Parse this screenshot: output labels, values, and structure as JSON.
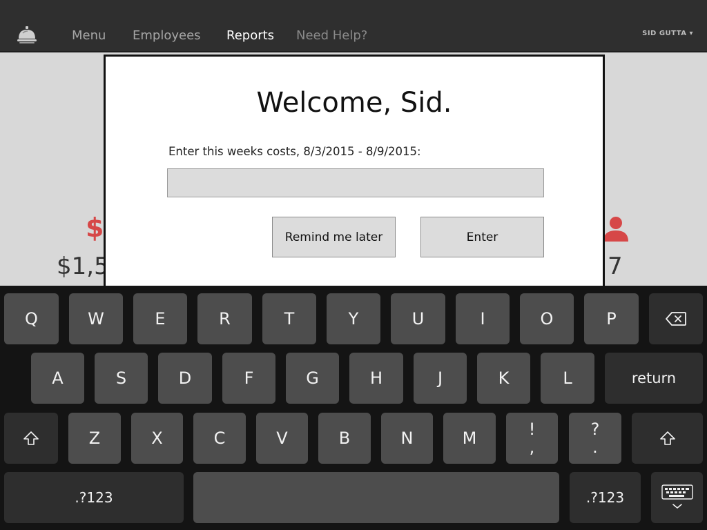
{
  "nav": {
    "logo_icon": "service-bell-icon",
    "items": [
      {
        "label": "Menu",
        "active": false
      },
      {
        "label": "Employees",
        "active": false
      },
      {
        "label": "Reports",
        "active": true
      },
      {
        "label": "Need Help?",
        "active": false
      }
    ],
    "user_label": "SID GUTTA ▾"
  },
  "background": {
    "cost_icon": "dollar-icon",
    "cost_icon_glyph": "$",
    "cost_value_partial": "$1,5",
    "staff_icon": "person-icon",
    "staff_value_partial": "7",
    "accent_color": "#d64747"
  },
  "modal": {
    "title": "Welcome, Sid.",
    "prompt": "Enter this weeks costs, 8/3/2015 - 8/9/2015:",
    "input_value": "",
    "remind_label": "Remind me later",
    "enter_label": "Enter"
  },
  "keyboard": {
    "row1": [
      "Q",
      "W",
      "E",
      "R",
      "T",
      "Y",
      "U",
      "I",
      "O",
      "P"
    ],
    "row2": [
      "A",
      "S",
      "D",
      "F",
      "G",
      "H",
      "J",
      "K",
      "L"
    ],
    "row3": [
      "Z",
      "X",
      "C",
      "V",
      "B",
      "N",
      "M"
    ],
    "punct1": {
      "top": "!",
      "bottom": ","
    },
    "punct2": {
      "top": "?",
      "bottom": "."
    },
    "return_label": "return",
    "mode_label": ".?123",
    "backspace_icon": "backspace-icon",
    "shift_icon": "shift-icon",
    "dismiss_icon": "keyboard-dismiss-icon"
  }
}
